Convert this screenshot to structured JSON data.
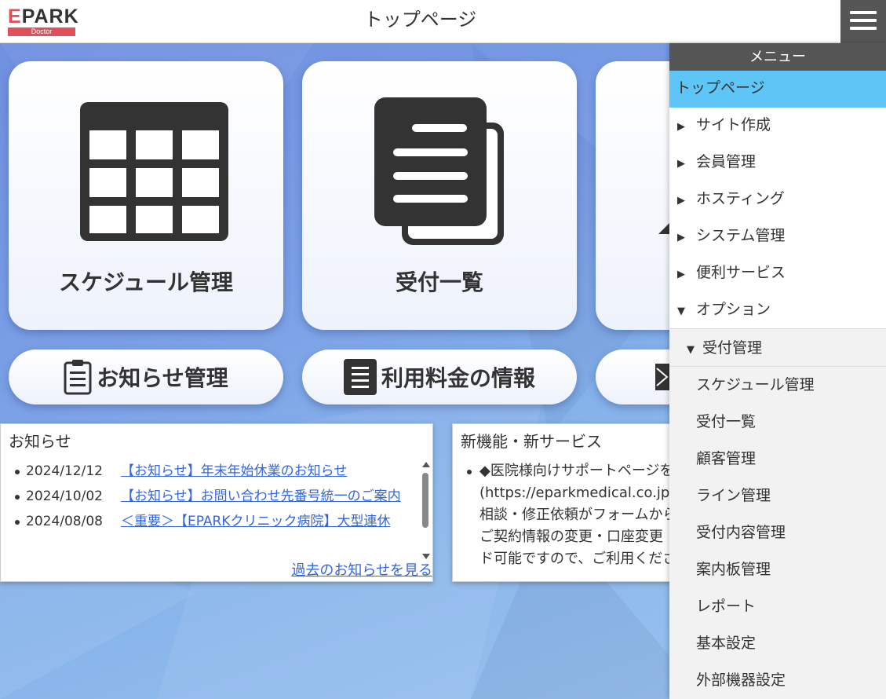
{
  "header": {
    "logo_text_e": "E",
    "logo_text_rest": "PARK",
    "logo_badge": "Doctor",
    "title": "トップページ"
  },
  "tiles": [
    {
      "label": "スケジュール管理",
      "icon": "table-grid-icon"
    },
    {
      "label": "受付一覧",
      "icon": "document-stack-icon"
    }
  ],
  "pills": [
    {
      "label": "お知らせ管理",
      "icon": "clipboard-icon"
    },
    {
      "label": "利用料金の情報",
      "icon": "document-lines-icon"
    }
  ],
  "news": {
    "title": "お知らせ",
    "items": [
      {
        "date": "2024/12/12",
        "text": "【お知らせ】年末年始休業のお知らせ"
      },
      {
        "date": "2024/10/02",
        "text": "【お知らせ】お問い合わせ先番号統一のご案内"
      },
      {
        "date": "2024/08/08",
        "text": "＜重要＞【EPARKクリニック病院】大型連休"
      }
    ],
    "more": "過去のお知らせを見る"
  },
  "services": {
    "title": "新機能・新サービス",
    "lines": [
      "◆医院様向けサポートページを",
      "(https://eparkmedical.co.jp/to",
      "相談・修正依頼がフォームから",
      "ご契約情報の変更・口座変更",
      "ド可能ですので、ご利用くださ"
    ]
  },
  "menu": {
    "header": "メニュー",
    "active": "トップページ",
    "items": [
      {
        "label": "サイト作成"
      },
      {
        "label": "会員管理"
      },
      {
        "label": "ホスティング"
      },
      {
        "label": "システム管理"
      },
      {
        "label": "便利サービス"
      }
    ],
    "option": "オプション",
    "submenu_head": "受付管理",
    "submenu": [
      "スケジュール管理",
      "受付一覧",
      "顧客管理",
      "ライン管理",
      "受付内容管理",
      "案内板管理",
      "レポート",
      "基本設定",
      "外部機器設定"
    ],
    "tri_collapsed": "▶",
    "tri_expanded": "▼"
  },
  "colors": {
    "accent": "#5ec6f7",
    "link": "#3366dd",
    "brand": "#e0505a",
    "menu_header": "#555555"
  }
}
